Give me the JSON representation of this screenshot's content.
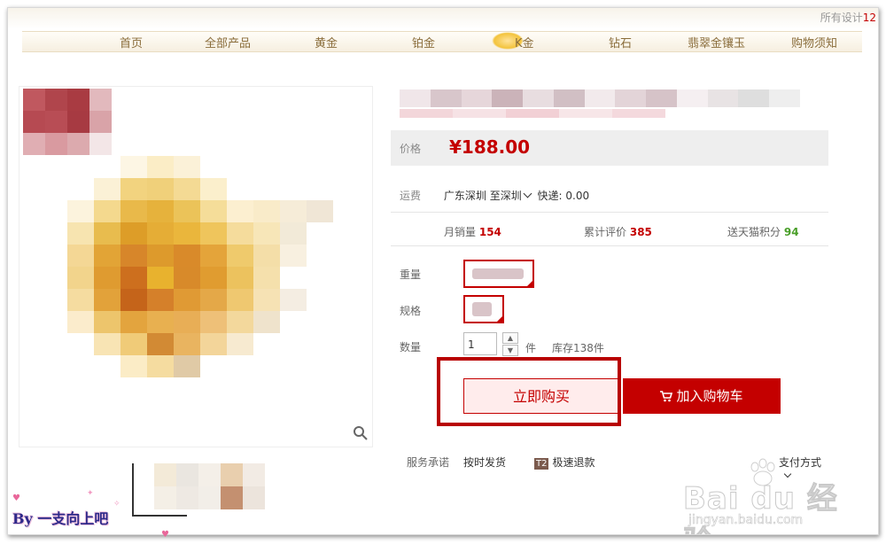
{
  "top": {
    "text": "所有设计",
    "number": "12"
  },
  "nav": {
    "items": [
      "首页",
      "全部产品",
      "黄金",
      "铂金",
      "K金",
      "钻石",
      "翡翠金镶玉",
      "购物须知"
    ]
  },
  "product": {
    "price_label": "价格",
    "price": "¥188.00",
    "shipping_label": "运费",
    "shipping_from": "广东深圳",
    "shipping_to": "至深圳",
    "shipping_method": "快递: 0.00",
    "stats": {
      "monthly_sales_label": "月销量",
      "monthly_sales": "154",
      "reviews_label": "累计评价",
      "reviews": "385",
      "points_label": "送天猫积分",
      "points": "94"
    },
    "weight_label": "重量",
    "spec_label": "规格",
    "qty_label": "数量",
    "qty_value": "1",
    "unit": "件",
    "stock": "库存138件",
    "buy_now": "立即购买",
    "add_to_cart": "加入购物车",
    "service_label": "服务承诺",
    "service_1": "按时发货",
    "t2_badge": "T2",
    "service_2": "极速退款",
    "payment": "支付方式"
  },
  "watermark": {
    "logo": "Bai du 经验",
    "url": "jingyan.baidu.com"
  },
  "credit": "By 一支向上吧",
  "colors": {
    "accent": "#c40000",
    "gold": "#8a6d3b",
    "green": "#4a9f2a"
  }
}
